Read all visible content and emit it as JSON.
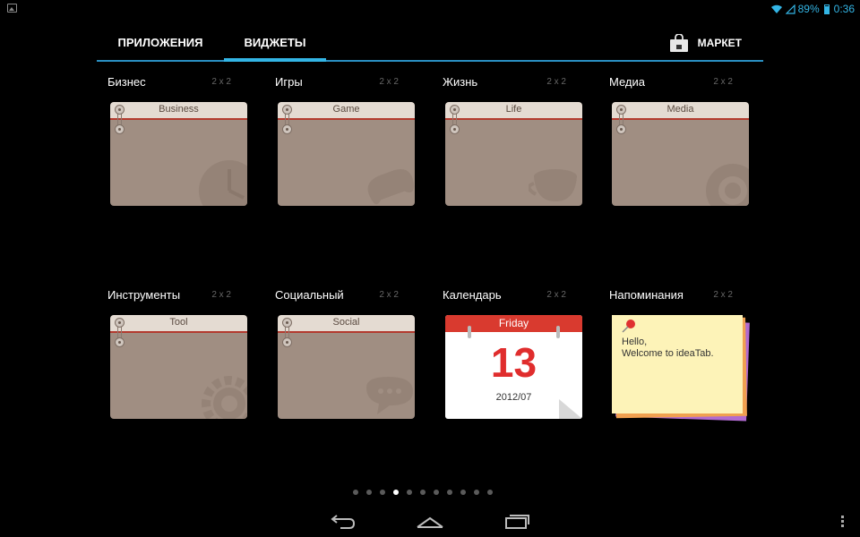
{
  "status_bar": {
    "battery": "89%",
    "time": "0:36"
  },
  "tabs": [
    {
      "label": "ПРИЛОЖЕНИЯ",
      "selected": false
    },
    {
      "label": "ВИДЖЕТЫ",
      "selected": true
    }
  ],
  "market": {
    "label": "МАРКЕТ"
  },
  "widgets": [
    {
      "label": "Бизнес",
      "size": "2 x 2",
      "preview_title": "Business",
      "icon": "clock-icon"
    },
    {
      "label": "Игры",
      "size": "2 x 2",
      "preview_title": "Game",
      "icon": "gamepad-icon"
    },
    {
      "label": "Жизнь",
      "size": "2 x 2",
      "preview_title": "Life",
      "icon": "cup-icon"
    },
    {
      "label": "Медиа",
      "size": "2 x 2",
      "preview_title": "Media",
      "icon": "disc-icon"
    },
    {
      "label": "Инструменты",
      "size": "2 x 2",
      "preview_title": "Tool",
      "icon": "gear-icon"
    },
    {
      "label": "Социальный",
      "size": "2 x 2",
      "preview_title": "Social",
      "icon": "chat-bubble-icon"
    },
    {
      "label": "Календарь",
      "size": "2 x 2",
      "cal_weekday": "Friday",
      "cal_day": "13",
      "cal_month": "2012/07"
    },
    {
      "label": "Напоминания",
      "size": "2 x 2",
      "note_line1": "Hello,",
      "note_line2": "Welcome to ideaTab."
    }
  ],
  "pager": {
    "total": 11,
    "active_index": 3
  },
  "colors": {
    "accent": "#33b5e5",
    "folder": "#a08e82",
    "calendar_red": "#d93a2f",
    "note_yellow": "#fdf3b8"
  }
}
